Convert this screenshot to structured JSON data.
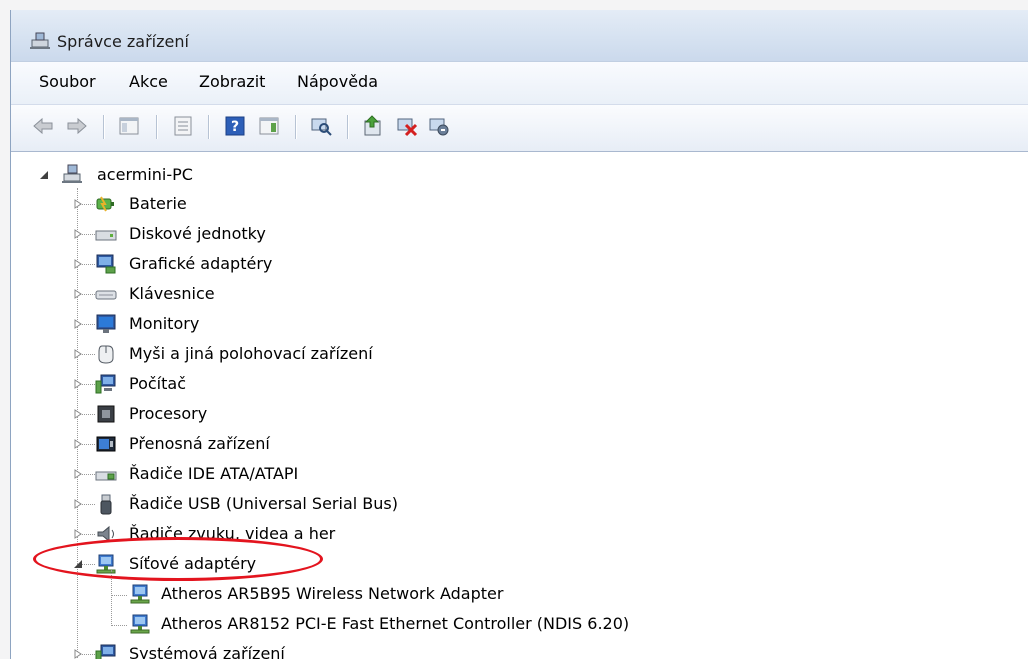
{
  "window": {
    "title": "Správce zařízení"
  },
  "menu": {
    "items": [
      "Soubor",
      "Akce",
      "Zobrazit",
      "Nápověda"
    ]
  },
  "toolbar": {
    "buttons": [
      "back-icon",
      "forward-icon",
      "console-tree-icon",
      "properties-icon",
      "help-icon",
      "action-pane-icon",
      "scan-hardware-icon",
      "update-driver-icon",
      "uninstall-icon",
      "disable-icon"
    ]
  },
  "tree": {
    "root": "acermini-PC",
    "categories": [
      "Baterie",
      "Diskové jednotky",
      "Grafické adaptéry",
      "Klávesnice",
      "Monitory",
      "Myši a jiná polohovací zařízení",
      "Počítač",
      "Procesory",
      "Přenosná zařízení",
      "Řadiče IDE ATA/ATAPI",
      "Řadiče USB (Universal Serial Bus)",
      "Řadiče zvuku, videa a her",
      "Síťové adaptéry",
      "Systémová zařízení"
    ],
    "expanded_category": "Síťové adaptéry",
    "network_children": [
      "Atheros AR5B95 Wireless Network Adapter",
      "Atheros AR8152 PCI-E Fast Ethernet Controller (NDIS 6.20)"
    ]
  },
  "colors": {
    "highlight": "#e3141e",
    "titlebar": "#d6e2f1"
  }
}
